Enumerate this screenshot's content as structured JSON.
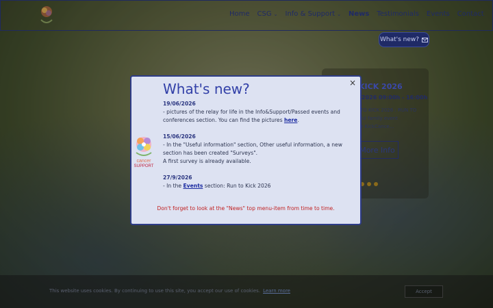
{
  "nav": {
    "items": [
      {
        "label": "Home",
        "active": false,
        "dropdown": false
      },
      {
        "label": "CSG",
        "active": false,
        "dropdown": true
      },
      {
        "label": "Info & Support",
        "active": false,
        "dropdown": true
      },
      {
        "label": "News",
        "active": true,
        "dropdown": false
      },
      {
        "label": "Testimonials",
        "active": false,
        "dropdown": false
      },
      {
        "label": "Events",
        "active": false,
        "dropdown": false
      },
      {
        "label": "Contact",
        "active": false,
        "dropdown": false
      }
    ],
    "chevron_glyph": "⌄"
  },
  "whats_new_button": {
    "label": "What's new?",
    "icon": "mail-icon"
  },
  "background_card": {
    "title": "KICK 2026",
    "date": "2026 09:00h - 16:00h",
    "text_lines": [
      "TO KICK 2026 : RUN TO",
      "ful family event",
      "e KickCance..."
    ],
    "more_label": "More Info"
  },
  "modal": {
    "title": "What's new?",
    "close_glyph": "×",
    "logo_text": [
      "cancer",
      "SUPPORT"
    ],
    "entries": [
      {
        "date": "19/06/2026",
        "pre": "- pictures of the relay for life in the Info&Support/Passed events and conferences section.  You can find the pictures ",
        "link": "here",
        "post": "."
      },
      {
        "date": "15/06/2026",
        "pre": "- In the \"Useful information\" section, Other useful information, a new section has been created \"Surveys\".",
        "line2": "A first survey is already available."
      },
      {
        "date": "27/9/2026",
        "pre": "- In the ",
        "link": "Events",
        "post": " section: Run to Kick 2026"
      }
    ],
    "footer": "Don't forget to look at the \"News\" top menu-item from time to time."
  },
  "cookie": {
    "text": "This website uses cookies. By continuing to use this site, you accept our use of cookies.",
    "link": "Learn more",
    "accept": "Accept"
  },
  "colors": {
    "accent": "#2e3c88",
    "alert": "#c12020",
    "modal_bg": "#dde2f2"
  }
}
